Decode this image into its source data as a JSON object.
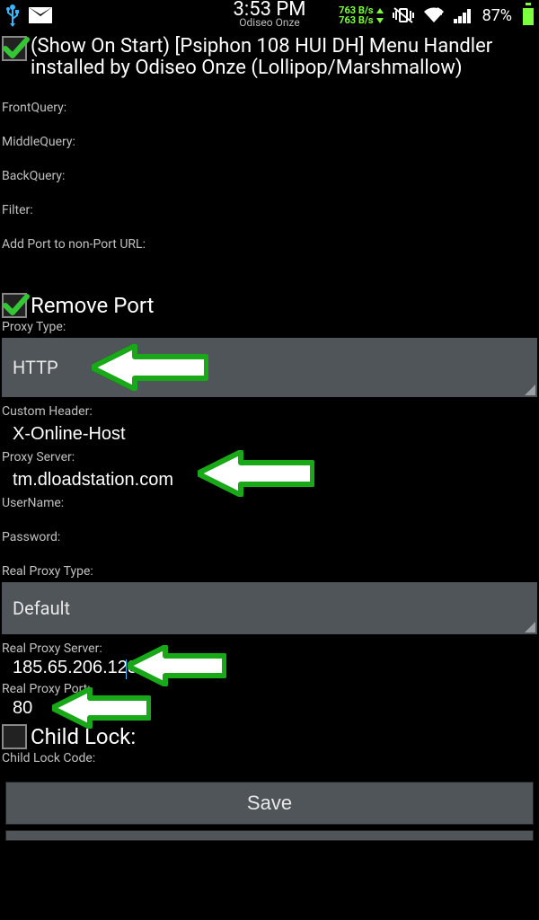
{
  "statusbar": {
    "time": "3:53 PM",
    "carrier": "Odiseo Onze",
    "net_up": "763 B/s",
    "net_down": "763 B/s",
    "battery_pct": "87%"
  },
  "headline": {
    "show_on_start_checked": true,
    "text": "(Show On Start) [Psiphon 108 HUI DH] Menu Handler installed by Odiseo Onze (Lollipop/Marshmallow)"
  },
  "labels": {
    "front_query": "FrontQuery:",
    "middle_query": "MiddleQuery:",
    "back_query": "BackQuery:",
    "filter": "Filter:",
    "add_port": "Add Port to non-Port URL:",
    "remove_port": "Remove Port",
    "proxy_type": "Proxy Type:",
    "custom_header": "Custom Header:",
    "proxy_server": "Proxy Server:",
    "username": "UserName:",
    "password": "Password:",
    "real_proxy_type": "Real Proxy Type:",
    "real_proxy_server": "Real Proxy Server:",
    "real_proxy_port": "Real Proxy Port:",
    "child_lock": "Child Lock:",
    "child_lock_code": "Child Lock Code:"
  },
  "values": {
    "proxy_type": "HTTP",
    "custom_header": "X-Online-Host",
    "proxy_server": "tm.dloadstation.com",
    "real_proxy_type": "Default",
    "real_proxy_server": "185.65.206.123",
    "real_proxy_port": "80"
  },
  "buttons": {
    "save": "Save"
  },
  "checkbox": {
    "remove_port_checked": true,
    "child_lock_checked": false
  }
}
